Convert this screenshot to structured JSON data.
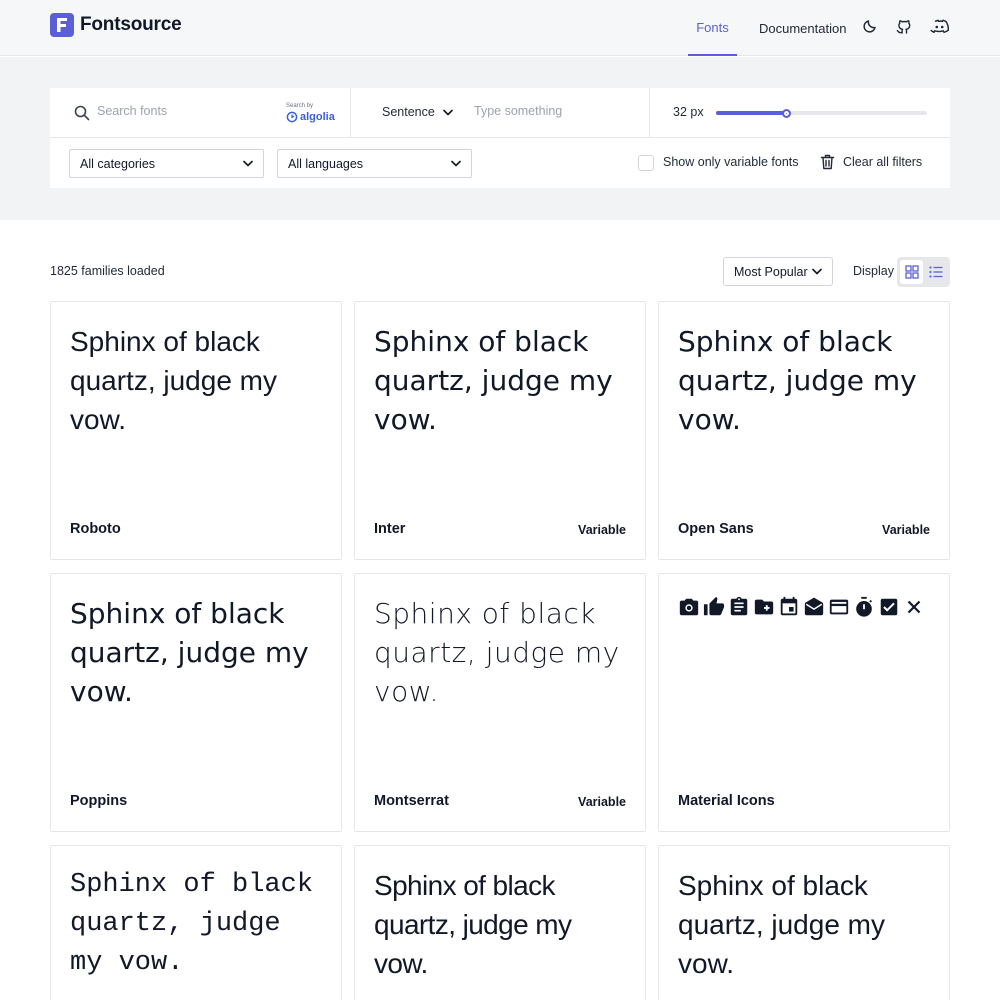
{
  "app": {
    "name": "Fontsource",
    "accent_color": "#5b5fd6"
  },
  "nav": {
    "fonts": "Fonts",
    "documentation": "Documentation",
    "icons": [
      "moon-icon",
      "github-icon",
      "discord-icon"
    ]
  },
  "filters": {
    "search_placeholder": "Search fonts",
    "search_by": "Search by",
    "search_provider": "algolia",
    "preview_type": "Sentence",
    "preview_placeholder": "Type something",
    "size_label": "32 px",
    "size_fraction": 0.33,
    "category_select": "All categories",
    "language_select": "All languages",
    "variable_only_label": "Show only variable fonts",
    "variable_only_checked": false,
    "clear_label": "Clear all filters"
  },
  "results": {
    "count_text": "1825 families loaded",
    "sort_value": "Most Popular",
    "display_label": "Display",
    "display_mode": "grid"
  },
  "cards": [
    {
      "name": "Roboto",
      "preview": "Sphinx of black quartz, judge my vow.",
      "badge": ""
    },
    {
      "name": "Inter",
      "preview": "Sphinx of black quartz, judge my vow.",
      "badge": "Variable"
    },
    {
      "name": "Open Sans",
      "preview": "Sphinx of black quartz, judge my vow.",
      "badge": "Variable"
    },
    {
      "name": "Poppins",
      "preview": "Sphinx of black quartz, judge my vow.",
      "badge": ""
    },
    {
      "name": "Montserrat",
      "preview": "Sphinx of black quartz, judge my vow.",
      "badge": "Variable"
    },
    {
      "name": "Material Icons",
      "preview_icons": [
        "camera-icon",
        "thumb-up-icon",
        "clipboard-icon",
        "folder-add-icon",
        "calendar-icon",
        "drafts-icon",
        "credit-card-icon",
        "timer-icon",
        "check-box-icon",
        "close-icon"
      ],
      "badge": ""
    },
    {
      "name": "",
      "preview": "Sphinx of black quartz, judge my vow.",
      "badge": ""
    },
    {
      "name": "",
      "preview": "Sphinx of black quartz, judge my vow.",
      "badge": ""
    },
    {
      "name": "",
      "preview": "Sphinx of black quartz, judge my vow.",
      "badge": ""
    }
  ]
}
